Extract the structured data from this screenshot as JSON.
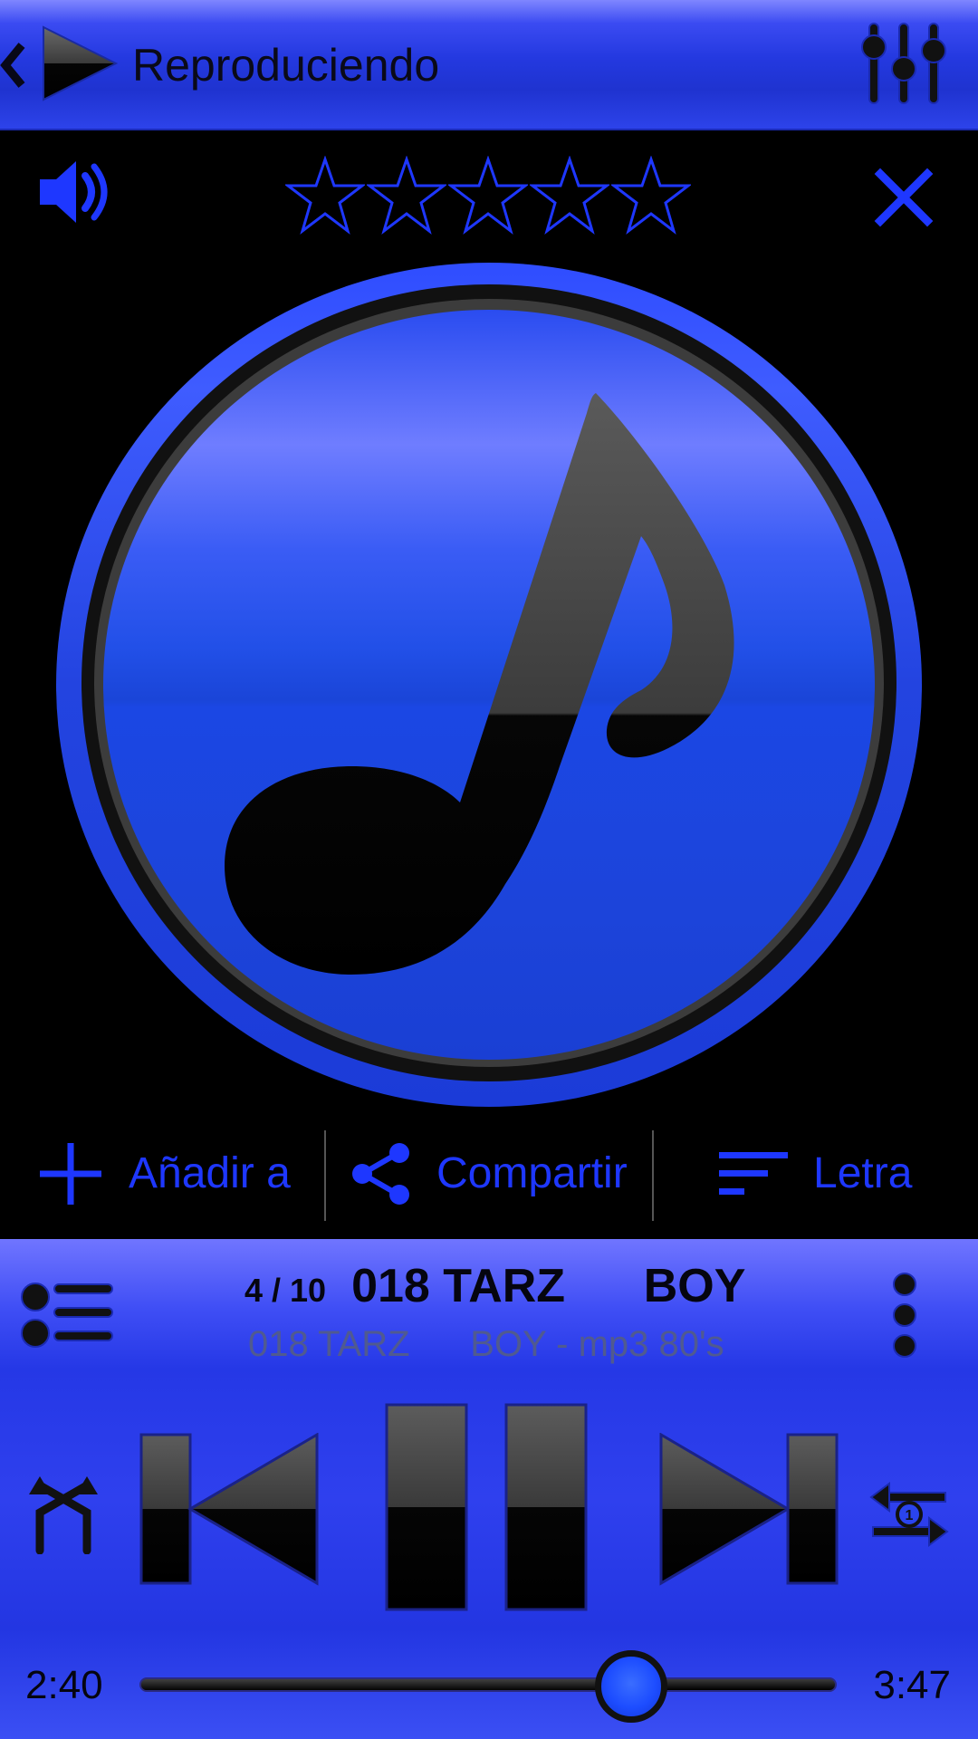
{
  "header": {
    "title": "Reproduciendo",
    "icons": {
      "back": "chevron-left-icon",
      "play": "play-icon",
      "equalizer": "equalizer-icon"
    }
  },
  "top_row": {
    "volume_icon": "volume-icon",
    "rating": {
      "stars_total": 5,
      "stars_filled": 0
    },
    "close_icon": "close-icon"
  },
  "album_art": {
    "icon": "music-note-icon"
  },
  "actions": [
    {
      "icon": "plus-icon",
      "label": "Añadir a"
    },
    {
      "icon": "share-icon",
      "label": "Compartir"
    },
    {
      "icon": "lyrics-icon",
      "label": "Letra"
    }
  ],
  "track": {
    "counter": "4 / 10",
    "title": "018 TARZ      BOY",
    "subtitle": "018 TARZ      BOY - mp3 80's"
  },
  "controls": {
    "shuffle": "shuffle-icon",
    "previous": "skip-previous-icon",
    "pause": "pause-icon",
    "next": "skip-next-icon",
    "repeat": "repeat-one-icon",
    "playlist": "playlist-icon",
    "more": "more-vertical-icon"
  },
  "progress": {
    "current_time": "2:40",
    "total_time": "3:47",
    "fraction": 0.705
  },
  "colors": {
    "accent": "#1e37ff",
    "panel_blue": "#2538e6",
    "background": "#000000"
  }
}
